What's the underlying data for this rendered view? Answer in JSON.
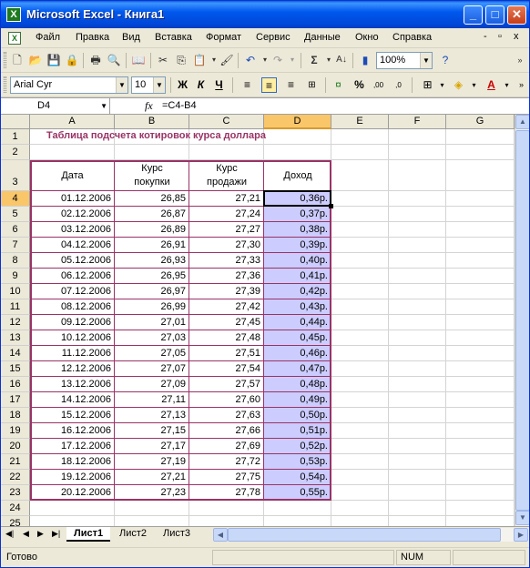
{
  "window": {
    "title": "Microsoft Excel - Книга1",
    "minimize_glyph": "_",
    "maximize_glyph": "□",
    "close_glyph": "✕"
  },
  "menu": {
    "items": [
      "Файл",
      "Правка",
      "Вид",
      "Вставка",
      "Формат",
      "Сервис",
      "Данные",
      "Окно",
      "Справка"
    ],
    "right_controls": [
      "-",
      "▫",
      "x"
    ]
  },
  "toolbar": {
    "zoom": "100%",
    "font_name": "Arial Cyr",
    "font_size": "10",
    "bold_label": "Ж",
    "italic_label": "К",
    "underline_label": "Ч",
    "percent_label": "%"
  },
  "formula_bar": {
    "cell_ref": "D4",
    "fx": "fx",
    "formula": "=C4-B4"
  },
  "columns": [
    "A",
    "B",
    "C",
    "D",
    "E",
    "F",
    "G"
  ],
  "rows": [
    "1",
    "2",
    "3",
    "4",
    "5",
    "6",
    "7",
    "8",
    "9",
    "10",
    "11",
    "12",
    "13",
    "14",
    "15",
    "16",
    "17",
    "18",
    "19",
    "20",
    "21",
    "22",
    "23",
    "24",
    "25"
  ],
  "sheet": {
    "title": "Таблица подсчета котировок курса доллара",
    "headers": {
      "date": "Дата",
      "buy_line1": "Курс",
      "buy_line2": "покупки",
      "sell_line1": "Курс",
      "sell_line2": "продажи",
      "income": "Доход"
    },
    "data": [
      [
        "01.12.2006",
        "26,85",
        "27,21",
        "0,36р."
      ],
      [
        "02.12.2006",
        "26,87",
        "27,24",
        "0,37р."
      ],
      [
        "03.12.2006",
        "26,89",
        "27,27",
        "0,38р."
      ],
      [
        "04.12.2006",
        "26,91",
        "27,30",
        "0,39р."
      ],
      [
        "05.12.2006",
        "26,93",
        "27,33",
        "0,40р."
      ],
      [
        "06.12.2006",
        "26,95",
        "27,36",
        "0,41р."
      ],
      [
        "07.12.2006",
        "26,97",
        "27,39",
        "0,42р."
      ],
      [
        "08.12.2006",
        "26,99",
        "27,42",
        "0,43р."
      ],
      [
        "09.12.2006",
        "27,01",
        "27,45",
        "0,44р."
      ],
      [
        "10.12.2006",
        "27,03",
        "27,48",
        "0,45р."
      ],
      [
        "11.12.2006",
        "27,05",
        "27,51",
        "0,46р."
      ],
      [
        "12.12.2006",
        "27,07",
        "27,54",
        "0,47р."
      ],
      [
        "13.12.2006",
        "27,09",
        "27,57",
        "0,48р."
      ],
      [
        "14.12.2006",
        "27,11",
        "27,60",
        "0,49р."
      ],
      [
        "15.12.2006",
        "27,13",
        "27,63",
        "0,50р."
      ],
      [
        "16.12.2006",
        "27,15",
        "27,66",
        "0,51р."
      ],
      [
        "17.12.2006",
        "27,17",
        "27,69",
        "0,52р."
      ],
      [
        "18.12.2006",
        "27,19",
        "27,72",
        "0,53р."
      ],
      [
        "19.12.2006",
        "27,21",
        "27,75",
        "0,54р."
      ],
      [
        "20.12.2006",
        "27,23",
        "27,78",
        "0,55р."
      ]
    ]
  },
  "tabs": [
    "Лист1",
    "Лист2",
    "Лист3"
  ],
  "status": {
    "ready": "Готово",
    "num": "NUM"
  },
  "colors": {
    "title_bar": "#0058ee",
    "table_border": "#993366",
    "income_fill": "#ccccff",
    "selected_header": "#f9c66a"
  }
}
